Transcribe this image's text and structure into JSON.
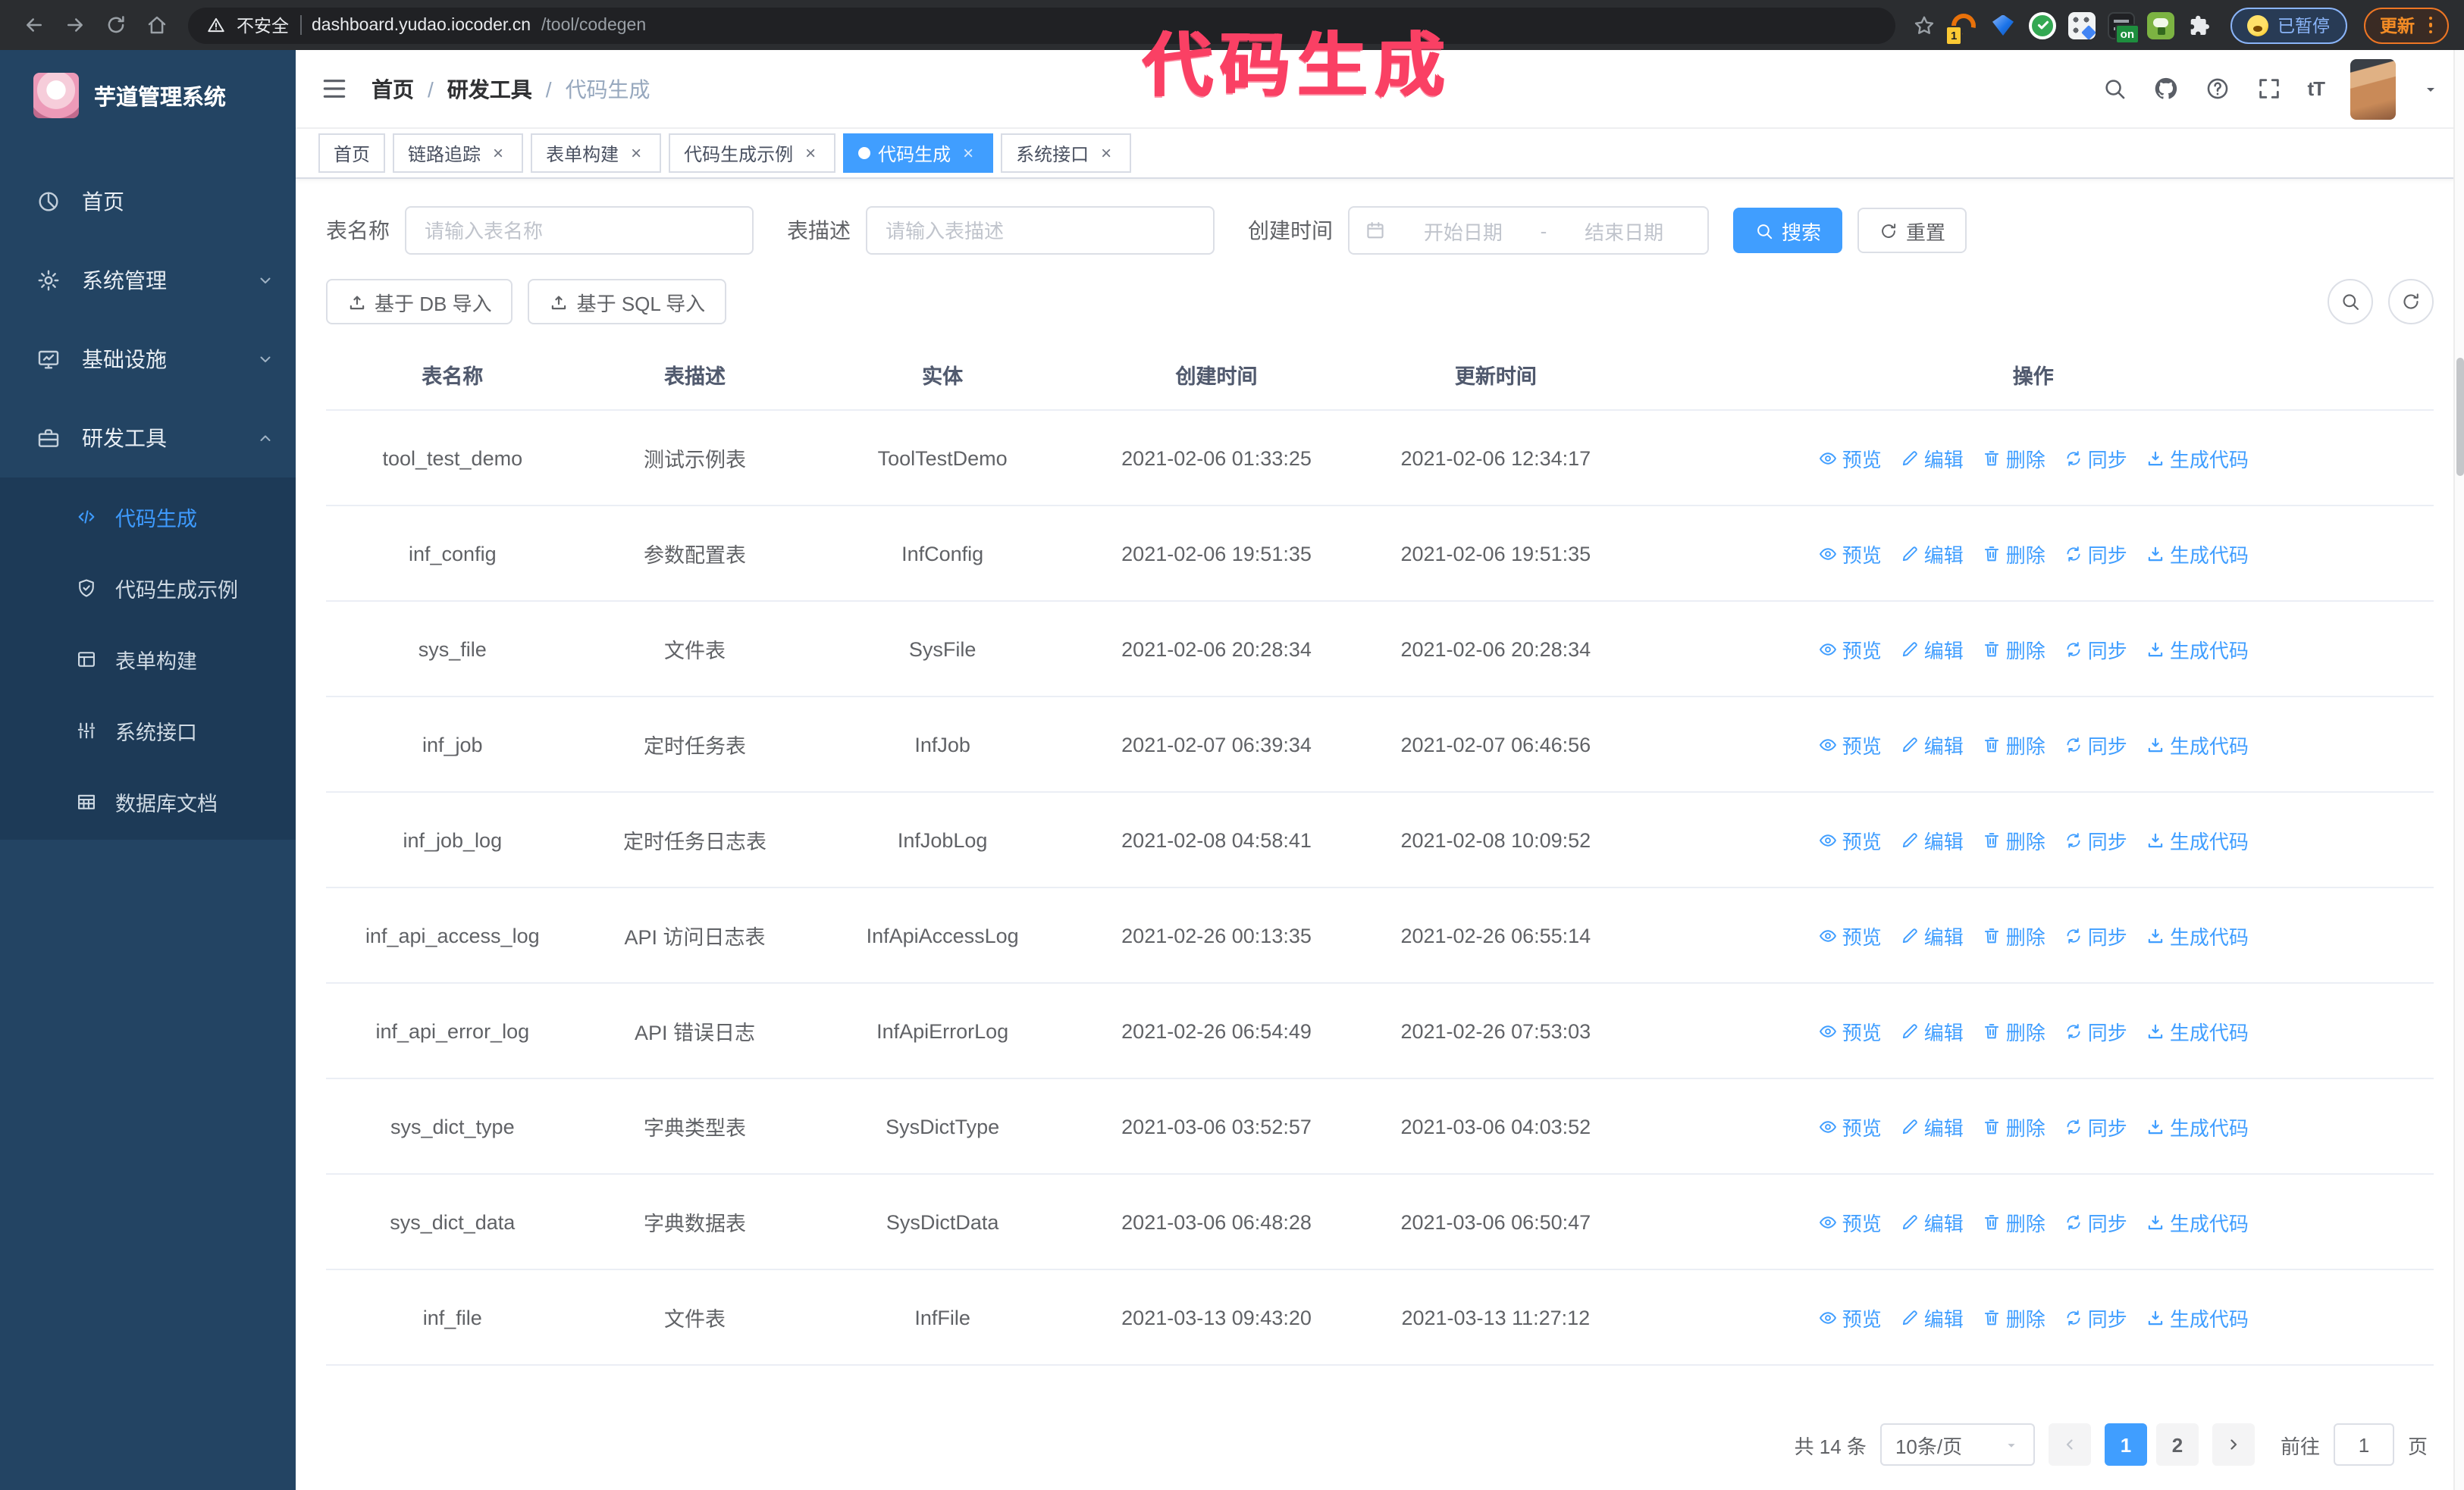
{
  "annotation": {
    "text": "代码生成",
    "color": "#fa4064"
  },
  "browser": {
    "security_warning": "不安全",
    "url_host": "dashboard.yudao.iocoder.cn",
    "url_path": "/tool/codegen",
    "paused_label": "已暂停",
    "update_label": "更新",
    "extensions": [
      {
        "key": "orange-c",
        "badge": "1"
      },
      {
        "key": "blue-gem"
      },
      {
        "key": "green-check"
      },
      {
        "key": "apps-grid"
      },
      {
        "key": "dark-panel",
        "badge": "on"
      },
      {
        "key": "green-bot"
      },
      {
        "key": "puzzle"
      }
    ]
  },
  "sidebar": {
    "title": "芋道管理系统",
    "items": [
      {
        "key": "home",
        "label": "首页",
        "icon": "dashboard"
      },
      {
        "key": "system",
        "label": "系统管理",
        "icon": "gear",
        "chevron": "down"
      },
      {
        "key": "infra",
        "label": "基础设施",
        "icon": "monitor",
        "chevron": "down"
      },
      {
        "key": "devtools",
        "label": "研发工具",
        "icon": "toolbox",
        "chevron": "up",
        "expanded": true
      }
    ],
    "submenu": [
      {
        "key": "codegen",
        "label": "代码生成",
        "icon": "code",
        "active": true
      },
      {
        "key": "codegen-example",
        "label": "代码生成示例",
        "icon": "shield-check"
      },
      {
        "key": "form-builder",
        "label": "表单构建",
        "icon": "form"
      },
      {
        "key": "system-api",
        "label": "系统接口",
        "icon": "sliders"
      },
      {
        "key": "db-doc",
        "label": "数据库文档",
        "icon": "db-table"
      }
    ]
  },
  "header": {
    "breadcrumb": [
      "首页",
      "研发工具",
      "代码生成"
    ]
  },
  "tabs": [
    {
      "label": "首页",
      "closable": false
    },
    {
      "label": "链路追踪",
      "closable": true
    },
    {
      "label": "表单构建",
      "closable": true
    },
    {
      "label": "代码生成示例",
      "closable": true
    },
    {
      "label": "代码生成",
      "closable": true,
      "active": true
    },
    {
      "label": "系统接口",
      "closable": true
    }
  ],
  "filters": {
    "table_name_label": "表名称",
    "table_name_placeholder": "请输入表名称",
    "table_desc_label": "表描述",
    "table_desc_placeholder": "请输入表描述",
    "create_time_label": "创建时间",
    "start_placeholder": "开始日期",
    "range_separator": "-",
    "end_placeholder": "结束日期",
    "search_label": "搜索",
    "reset_label": "重置"
  },
  "toolbar": {
    "import_db_label": "基于 DB 导入",
    "import_sql_label": "基于 SQL 导入"
  },
  "table": {
    "columns": [
      "表名称",
      "表描述",
      "实体",
      "创建时间",
      "更新时间",
      "操作"
    ],
    "row_actions": [
      {
        "key": "preview",
        "label": "预览",
        "icon": "eye"
      },
      {
        "key": "edit",
        "label": "编辑",
        "icon": "edit"
      },
      {
        "key": "delete",
        "label": "删除",
        "icon": "trash"
      },
      {
        "key": "sync",
        "label": "同步",
        "icon": "sync"
      },
      {
        "key": "generate-code",
        "label": "生成代码",
        "icon": "download"
      }
    ],
    "rows": [
      {
        "name": "tool_test_demo",
        "desc": "测试示例表",
        "entity": "ToolTestDemo",
        "created": "2021-02-06 01:33:25",
        "updated": "2021-02-06 12:34:17"
      },
      {
        "name": "inf_config",
        "desc": "参数配置表",
        "entity": "InfConfig",
        "created": "2021-02-06 19:51:35",
        "updated": "2021-02-06 19:51:35"
      },
      {
        "name": "sys_file",
        "desc": "文件表",
        "entity": "SysFile",
        "created": "2021-02-06 20:28:34",
        "updated": "2021-02-06 20:28:34"
      },
      {
        "name": "inf_job",
        "desc": "定时任务表",
        "entity": "InfJob",
        "created": "2021-02-07 06:39:34",
        "updated": "2021-02-07 06:46:56"
      },
      {
        "name": "inf_job_log",
        "desc": "定时任务日志表",
        "entity": "InfJobLog",
        "created": "2021-02-08 04:58:41",
        "updated": "2021-02-08 10:09:52"
      },
      {
        "name": "inf_api_access_log",
        "desc": "API 访问日志表",
        "entity": "InfApiAccessLog",
        "created": "2021-02-26 00:13:35",
        "updated": "2021-02-26 06:55:14"
      },
      {
        "name": "inf_api_error_log",
        "desc": "API 错误日志",
        "entity": "InfApiErrorLog",
        "created": "2021-02-26 06:54:49",
        "updated": "2021-02-26 07:53:03"
      },
      {
        "name": "sys_dict_type",
        "desc": "字典类型表",
        "entity": "SysDictType",
        "created": "2021-03-06 03:52:57",
        "updated": "2021-03-06 04:03:52"
      },
      {
        "name": "sys_dict_data",
        "desc": "字典数据表",
        "entity": "SysDictData",
        "created": "2021-03-06 06:48:28",
        "updated": "2021-03-06 06:50:47"
      },
      {
        "name": "inf_file",
        "desc": "文件表",
        "entity": "InfFile",
        "created": "2021-03-13 09:43:20",
        "updated": "2021-03-13 11:27:12"
      }
    ]
  },
  "pagination": {
    "total": "共 14 条",
    "page_size": "10条/页",
    "pages": [
      "1",
      "2"
    ],
    "active_page": "1",
    "goto_label": "前往",
    "goto_value": "1",
    "goto_unit": "页"
  },
  "colors": {
    "accent": "#409eff",
    "link": "#409eff",
    "sidebar_bg": "#234463",
    "submenu_bg": "#1d3a57",
    "tab_active_bg": "#409eff",
    "annotation": "#fa4064",
    "update_button": "#f28b25",
    "paused_badge_border": "#8ab4f8"
  }
}
